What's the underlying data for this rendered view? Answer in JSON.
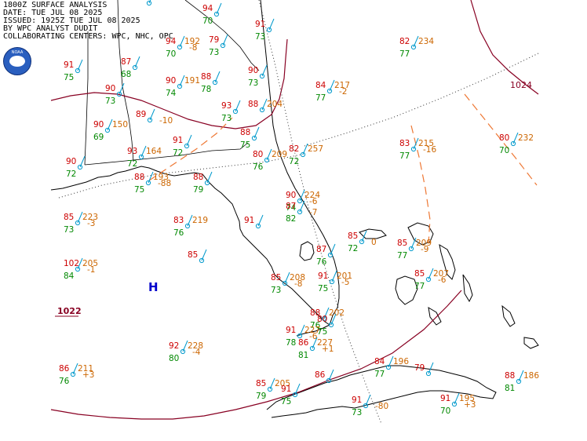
{
  "header": {
    "line1": "1800Z SURFACE ANALYSIS",
    "line2": "DATE: TUE JUL 08 2025",
    "line3": "ISSUED: 1925Z TUE JUL 08 2025",
    "line4": "BY WPC ANALYST DUDIT",
    "line5": "COLLABORATING CENTERS: WPC, NHC, OPC"
  },
  "logo": {
    "icon": "noaa-logo-icon",
    "text": "NOAA"
  },
  "pressure_centers": [
    {
      "label": "H",
      "value": "1022",
      "color": "#0000cc"
    }
  ],
  "isobar_labels": [
    "1024",
    "1022"
  ],
  "colors": {
    "temperature": "#cc0000",
    "dewpoint": "#008800",
    "pressure": "#cc6600",
    "station": "#0099cc",
    "isobar": "#880022",
    "trough": "#ee7733",
    "high": "#0000cc"
  },
  "stations": [
    {
      "t": "94",
      "d": "70",
      "p": "",
      "tend": ""
    },
    {
      "t": "91",
      "d": "73",
      "p": "",
      "tend": ""
    },
    {
      "t": "94",
      "d": "70",
      "p": "192",
      "tend": "-8"
    },
    {
      "t": "79",
      "d": "73",
      "p": "",
      "tend": ""
    },
    {
      "t": "91",
      "d": "75",
      "p": "",
      "tend": ""
    },
    {
      "t": "87",
      "d": "68",
      "p": "",
      "tend": ""
    },
    {
      "t": "90",
      "d": "74",
      "p": "191",
      "tend": ""
    },
    {
      "t": "88",
      "d": "78",
      "p": "",
      "tend": ""
    },
    {
      "t": "90",
      "d": "73",
      "p": "",
      "tend": ""
    },
    {
      "t": "90",
      "d": "73",
      "p": "",
      "tend": ""
    },
    {
      "t": "88",
      "d": "",
      "p": "204",
      "tend": ""
    },
    {
      "t": "93",
      "d": "73",
      "p": "",
      "tend": ""
    },
    {
      "t": "89",
      "d": "",
      "p": "",
      "tend": "-10"
    },
    {
      "t": "90",
      "d": "69",
      "p": "150",
      "tend": ""
    },
    {
      "t": "88",
      "d": "75",
      "p": "",
      "tend": ""
    },
    {
      "t": "91",
      "d": "72",
      "p": "",
      "tend": ""
    },
    {
      "t": "93",
      "d": "72",
      "p": "164",
      "tend": ""
    },
    {
      "t": "80",
      "d": "76",
      "p": "209",
      "tend": ""
    },
    {
      "t": "82",
      "d": "72",
      "p": "257",
      "tend": ""
    },
    {
      "t": "84",
      "d": "77",
      "p": "217",
      "tend": "-2"
    },
    {
      "t": "82",
      "d": "77",
      "p": "234",
      "tend": ""
    },
    {
      "t": "83",
      "d": "77",
      "p": "215",
      "tend": "-16"
    },
    {
      "t": "80",
      "d": "70",
      "p": "232",
      "tend": ""
    },
    {
      "t": "88",
      "d": "75",
      "p": "193",
      "tend": "-88"
    },
    {
      "t": "88",
      "d": "79",
      "p": "",
      "tend": ""
    },
    {
      "t": "90",
      "d": "72",
      "p": "",
      "tend": ""
    },
    {
      "t": "85",
      "d": "73",
      "p": "223",
      "tend": "-3"
    },
    {
      "t": "83",
      "d": "76",
      "p": "219",
      "tend": ""
    },
    {
      "t": "91",
      "d": "",
      "p": "",
      "tend": ""
    },
    {
      "t": "90",
      "d": "74",
      "p": "224",
      "tend": "-6"
    },
    {
      "t": "87",
      "d": "82",
      "p": "",
      "tend": "-7"
    },
    {
      "t": "85",
      "d": "72",
      "p": "",
      "tend": "0"
    },
    {
      "t": "85",
      "d": "77",
      "p": "209",
      "tend": "-9"
    },
    {
      "t": "87",
      "d": "76",
      "p": "",
      "tend": ""
    },
    {
      "t": "102",
      "d": "84",
      "p": "205",
      "tend": "-1"
    },
    {
      "t": "85",
      "d": "",
      "p": "",
      "tend": ""
    },
    {
      "t": "85",
      "d": "73",
      "p": "208",
      "tend": "-8"
    },
    {
      "t": "91",
      "d": "75",
      "p": "201",
      "tend": "-5"
    },
    {
      "t": "85",
      "d": "77",
      "p": "207",
      "tend": "-6"
    },
    {
      "t": "88",
      "d": "76",
      "p": "202",
      "tend": ""
    },
    {
      "t": "91",
      "d": "78",
      "p": "227",
      "tend": "-6"
    },
    {
      "t": "86",
      "d": "81",
      "p": "227",
      "tend": "+1"
    },
    {
      "t": "92",
      "d": "80",
      "p": "228",
      "tend": "-4"
    },
    {
      "t": "86",
      "d": "76",
      "p": "211",
      "tend": "+3"
    },
    {
      "t": "86",
      "d": "",
      "p": "",
      "tend": ""
    },
    {
      "t": "85",
      "d": "79",
      "p": "205",
      "tend": ""
    },
    {
      "t": "91",
      "d": "75",
      "p": "",
      "tend": ""
    },
    {
      "t": "84",
      "d": "77",
      "p": "196",
      "tend": ""
    },
    {
      "t": "79",
      "d": "",
      "p": "",
      "tend": ""
    },
    {
      "t": "91",
      "d": "73",
      "p": "",
      "tend": "-80"
    },
    {
      "t": "91",
      "d": "70",
      "p": "195",
      "tend": "+3"
    },
    {
      "t": "88",
      "d": "81",
      "p": "186",
      "tend": ""
    },
    {
      "t": "80",
      "d": "75",
      "p": "",
      "tend": ""
    },
    {
      "t": "68",
      "d": "",
      "p": "",
      "tend": ""
    }
  ]
}
